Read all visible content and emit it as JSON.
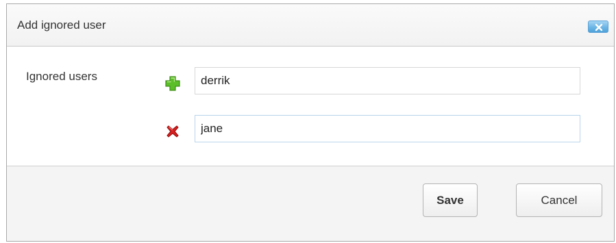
{
  "dialog": {
    "title": "Add ignored user",
    "close_icon": "close-icon",
    "field_label": "Ignored users",
    "users": [
      {
        "value": "derrik",
        "action_icon": "add-icon"
      },
      {
        "value": "jane",
        "action_icon": "remove-icon"
      }
    ],
    "buttons": {
      "save_label": "Save",
      "cancel_label": "Cancel"
    }
  },
  "colors": {
    "add_icon": "#5cbf2a",
    "remove_icon": "#d81e1e",
    "close_button": "#6cb6e6",
    "footer_background": "#f4f4f4"
  }
}
